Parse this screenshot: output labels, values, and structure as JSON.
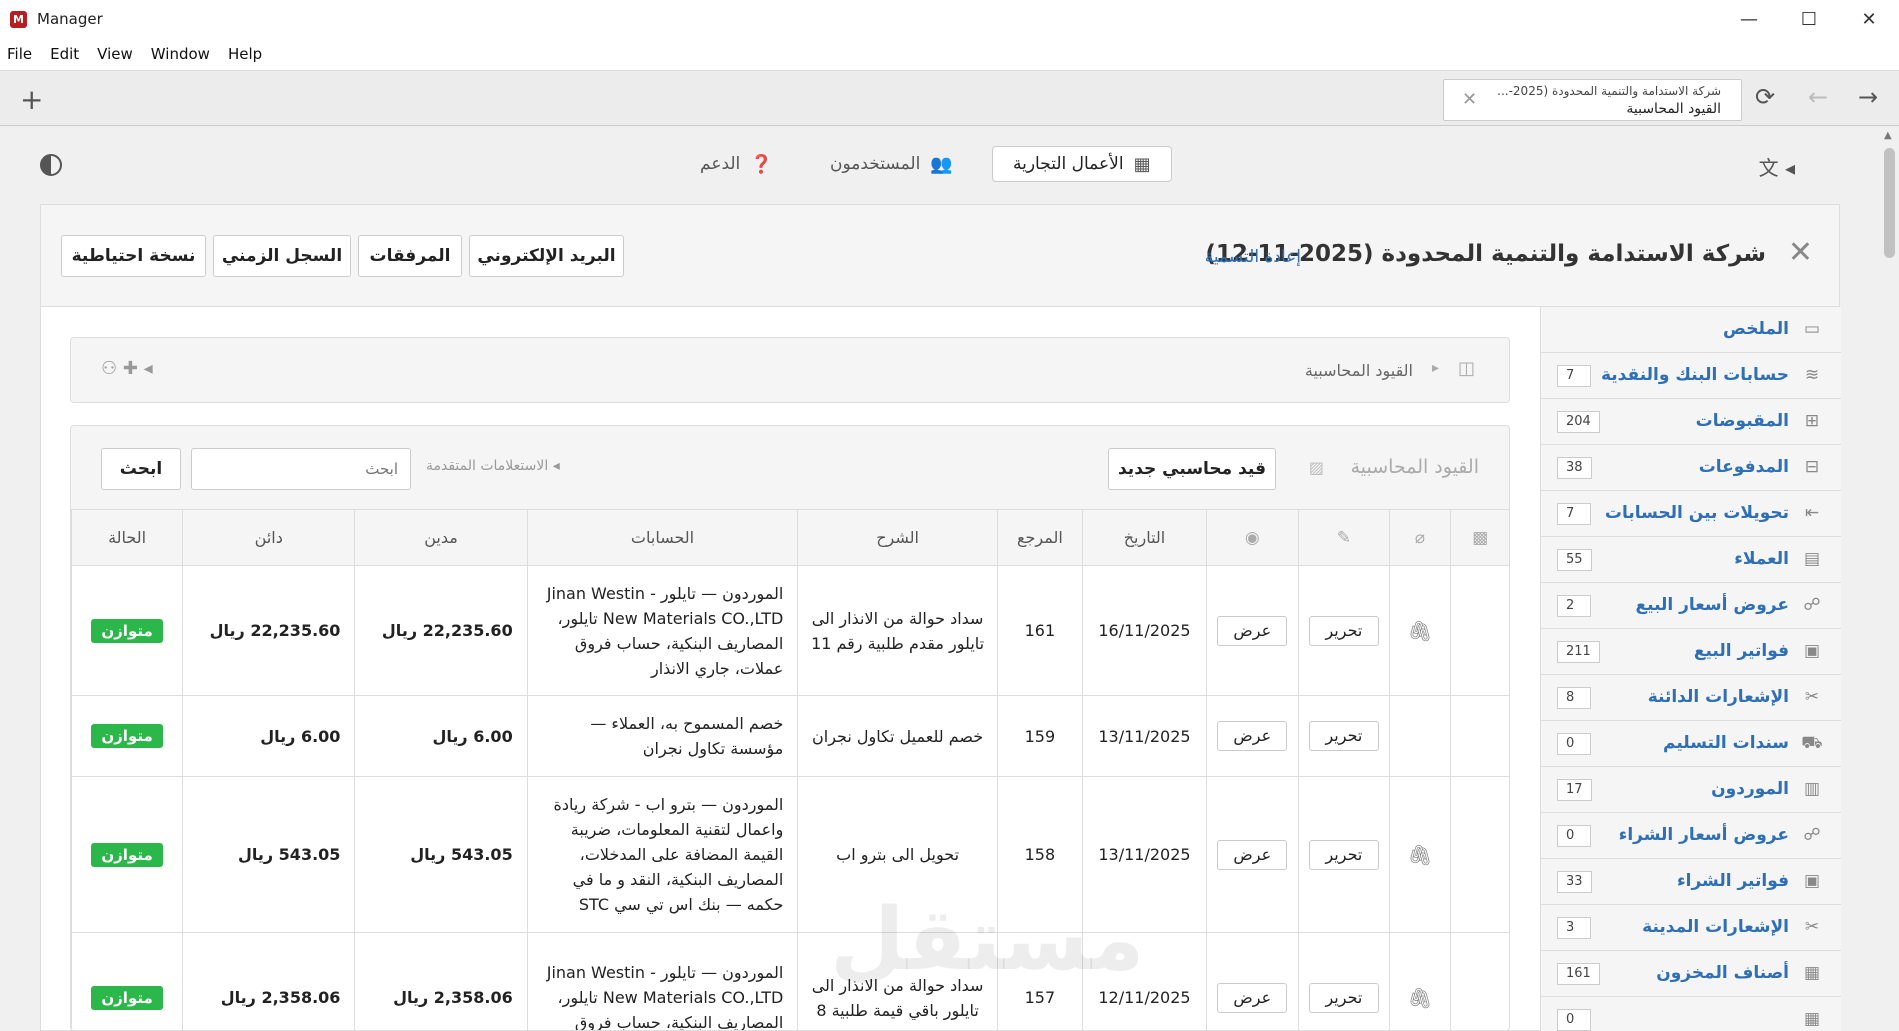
{
  "window": {
    "logo": "M",
    "title": "Manager",
    "minimize": "—",
    "maximize": "☐",
    "close": "✕"
  },
  "menu": [
    "File",
    "Edit",
    "View",
    "Window",
    "Help"
  ],
  "address": {
    "line1": "شركة الاستدامة والتنمية المحدودة (2025-...",
    "line2": "القيود المحاسبية",
    "clear": "✕"
  },
  "topnav": {
    "business": "الأعمال التجارية",
    "users": "المستخدمون",
    "support": "الدعم"
  },
  "header": {
    "title": "شركة الاستدامة والتنمية المحدودة (2025-11-12)",
    "rename": "إعادة التسمية",
    "buttons": {
      "email": "البريد الإلكتروني",
      "attachments": "المرفقات",
      "history": "السجل الزمني",
      "backup": "نسخة احتياطية"
    }
  },
  "sidebar": [
    {
      "label": "الملخص",
      "count": null,
      "icon": "monitor-icon"
    },
    {
      "label": "حسابات البنك والنقدية",
      "count": "7",
      "icon": "coins-icon"
    },
    {
      "label": "المقبوضات",
      "count": "204",
      "icon": "plus-square-icon"
    },
    {
      "label": "المدفوعات",
      "count": "38",
      "icon": "minus-square-icon"
    },
    {
      "label": "تحويلات بين الحسابات",
      "count": "7",
      "icon": "transfer-icon"
    },
    {
      "label": "العملاء",
      "count": "55",
      "icon": "customers-icon"
    },
    {
      "label": "عروض أسعار البيع",
      "count": "2",
      "icon": "quote-icon"
    },
    {
      "label": "فواتير البيع",
      "count": "211",
      "icon": "invoice-icon"
    },
    {
      "label": "الإشعارات الدائنة",
      "count": "8",
      "icon": "scissors-icon"
    },
    {
      "label": "سندات التسليم",
      "count": "0",
      "icon": "truck-icon"
    },
    {
      "label": "الموردون",
      "count": "17",
      "icon": "factory-icon"
    },
    {
      "label": "عروض أسعار الشراء",
      "count": "0",
      "icon": "quote-icon"
    },
    {
      "label": "فواتير الشراء",
      "count": "33",
      "icon": "invoice-icon"
    },
    {
      "label": "الإشعارات المدينة",
      "count": "3",
      "icon": "scissors-icon"
    },
    {
      "label": "أصناف المخزون",
      "count": "161",
      "icon": "inventory-icon"
    },
    {
      "label": "",
      "count": "0",
      "icon": "inventory-icon"
    }
  ],
  "breadcrumb": {
    "current": "القيود المحاسبية"
  },
  "entries": {
    "title": "القيود المحاسبية",
    "new_button": "قيد محاسبي جديد",
    "advanced": "◂ الاستعلامات المتقدمة",
    "search_placeholder": "ابحث",
    "search_button": "ابحث",
    "columns": {
      "date": "التاريخ",
      "ref": "المرجع",
      "desc": "الشرح",
      "accounts": "الحسابات",
      "debit": "مدين",
      "credit": "دائن",
      "status": "الحالة"
    },
    "edit_label": "تحرير",
    "view_label": "عرض",
    "rows": [
      {
        "clip": true,
        "date": "16/11/2025",
        "ref": "161",
        "desc": "سداد حوالة من الانذار الى تايلور مقدم طلبية رقم 11",
        "accounts": "الموردون — تايلور - Jinan Westin New Materials CO.,LTD تايلور، المصاريف البنكية، حساب فروق عملات، جاري الانذار",
        "debit": "22,235.60 ريال",
        "credit": "22,235.60 ريال",
        "status": "متوازن"
      },
      {
        "clip": false,
        "date": "13/11/2025",
        "ref": "159",
        "desc": "خصم للعميل تكاول نجران",
        "accounts": "خصم المسموح به، العملاء — مؤسسة تكاول نجران",
        "debit": "6.00 ريال",
        "credit": "6.00 ريال",
        "status": "متوازن"
      },
      {
        "clip": true,
        "date": "13/11/2025",
        "ref": "158",
        "desc": "تحويل الى بترو اب",
        "accounts": "الموردون — بترو اب - شركة ريادة واعمال لتقنية المعلومات، ضريبة القيمة المضافة على المدخلات، المصاريف البنكية، النقد و ما في حكمه — بنك اس تي سي STC",
        "debit": "543.05 ريال",
        "credit": "543.05 ريال",
        "status": "متوازن"
      },
      {
        "clip": true,
        "date": "12/11/2025",
        "ref": "157",
        "desc": "سداد حوالة من الانذار الى تايلور باقي قيمة طلبية 8",
        "accounts": "الموردون — تايلور - Jinan Westin New Materials CO.,LTD تايلور، المصاريف البنكية، حساب فروق",
        "debit": "2,358.06 ريال",
        "credit": "2,358.06 ريال",
        "status": "متوازن"
      }
    ]
  },
  "watermark": "مستقل",
  "colors": {
    "accent_link": "#2e6fb5",
    "status_green": "#2bb74a",
    "logo_red": "#b81d24"
  }
}
